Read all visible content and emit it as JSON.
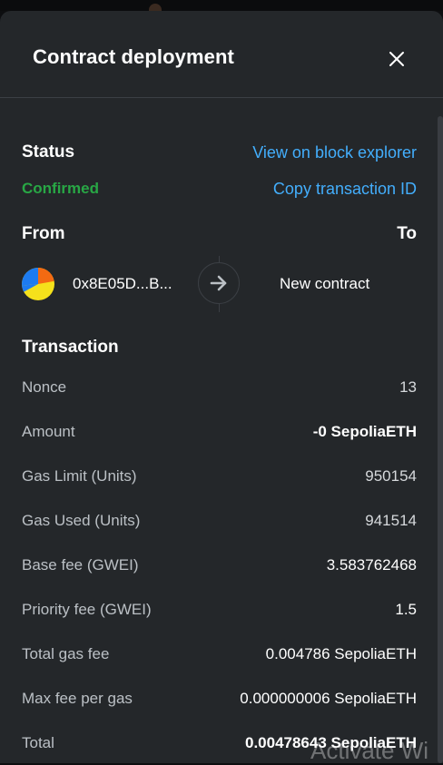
{
  "modal": {
    "title": "Contract deployment"
  },
  "status": {
    "heading": "Status",
    "value": "Confirmed",
    "view_explorer_link": "View on block explorer",
    "copy_tx_link": "Copy transaction ID"
  },
  "from_to": {
    "from_heading": "From",
    "to_heading": "To",
    "from_address": "0x8E05D...B...",
    "to_label": "New contract"
  },
  "transaction": {
    "heading": "Transaction",
    "rows": [
      {
        "label": "Nonce",
        "value": "13"
      },
      {
        "label": "Amount",
        "value": "-0 SepoliaETH"
      },
      {
        "label": "Gas Limit (Units)",
        "value": "950154"
      },
      {
        "label": "Gas Used (Units)",
        "value": "941514"
      },
      {
        "label": "Base fee (GWEI)",
        "value": "3.583762468"
      },
      {
        "label": "Priority fee (GWEI)",
        "value": "1.5"
      },
      {
        "label": "Total gas fee",
        "value": "0.004786 SepoliaETH"
      },
      {
        "label": "Max fee per gas",
        "value": "0.000000006 SepoliaETH"
      },
      {
        "label": "Total",
        "value": "0.00478643 SepoliaETH"
      }
    ]
  },
  "overlay": {
    "watermark": "Activate Wi"
  },
  "colors": {
    "background": "#24272a",
    "accent_link": "#43aefc",
    "success": "#28a745",
    "label": "#bbc0c5"
  }
}
